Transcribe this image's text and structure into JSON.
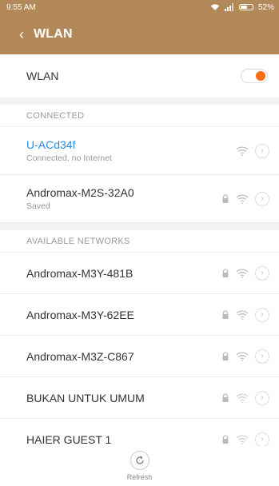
{
  "status_bar": {
    "time": "9:55 AM",
    "battery_text": "52%"
  },
  "header": {
    "title": "WLAN",
    "back_icon": "chevron-left-icon"
  },
  "wlan_toggle": {
    "label": "WLAN",
    "on": true,
    "accent": "#ff6c12"
  },
  "connected_section": {
    "header": "CONNECTED",
    "networks": [
      {
        "ssid": "U-ACd34f",
        "status": "Connected, no Internet",
        "locked": false
      },
      {
        "ssid": "Andromax-M2S-32A0",
        "status": "Saved",
        "locked": true
      }
    ]
  },
  "available_section": {
    "header": "AVAILABLE NETWORKS",
    "networks": [
      {
        "ssid": "Andromax-M3Y-481B",
        "locked": true
      },
      {
        "ssid": "Andromax-M3Y-62EE",
        "locked": true
      },
      {
        "ssid": "Andromax-M3Z-C867",
        "locked": true
      },
      {
        "ssid": "BUKAN UNTUK UMUM",
        "locked": true
      },
      {
        "ssid": "HAIER GUEST 1",
        "locked": true
      }
    ]
  },
  "refresh": {
    "label": "Refresh"
  },
  "colors": {
    "header_bg": "#b4895a",
    "link": "#2a8de6"
  }
}
